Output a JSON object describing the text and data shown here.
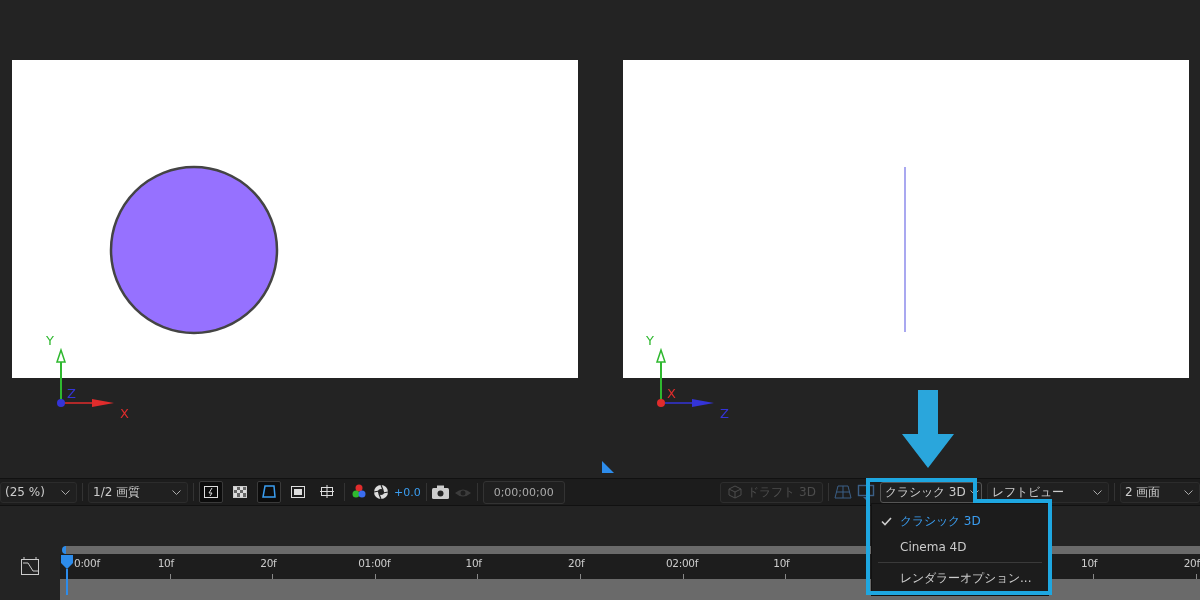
{
  "viewers": [
    {
      "kind": "front",
      "axes": [
        {
          "kind": "up",
          "label": "Y",
          "color": "#2fb82f"
        },
        {
          "kind": "depth",
          "label": "Z",
          "color": "#3434d8"
        },
        {
          "kind": "right",
          "label": "X",
          "color": "#e02c2c"
        }
      ]
    },
    {
      "kind": "side",
      "axes": [
        {
          "kind": "up",
          "label": "Y",
          "color": "#2fb82f"
        },
        {
          "kind": "depth",
          "label": "X",
          "color": "#e02c2c"
        },
        {
          "kind": "right",
          "label": "Z",
          "color": "#3434d8"
        }
      ]
    }
  ],
  "toolbar": {
    "zoom": {
      "value": "(25 %)"
    },
    "resolution": {
      "value": "1/2 画質"
    },
    "view_toggles": [
      {
        "selected": true
      },
      {
        "selected": false
      },
      {
        "selected": true
      },
      {
        "selected": false
      },
      {
        "selected": false
      }
    ],
    "exposure": "+0.0",
    "snapshot_show": {
      "disabled": true
    },
    "timecode": "0;00;00;00",
    "draft_3d": {
      "label": "ドラフト 3D",
      "disabled": true
    },
    "renderer": {
      "value": "クラシック 3D",
      "expanded": true
    },
    "view": {
      "value": "レフトビュー"
    },
    "layout": {
      "value": "2 画面"
    }
  },
  "renderer_menu": [
    {
      "kind": "item",
      "label": "クラシック 3D",
      "checked": true
    },
    {
      "kind": "item",
      "label": "Cinema 4D",
      "checked": false
    },
    {
      "kind": "separator"
    },
    {
      "kind": "item",
      "label": "レンダラーオプション...",
      "checked": false
    }
  ],
  "timeline": {
    "ticks": [
      {
        "label": "0:00f"
      },
      {
        "label": "10f"
      },
      {
        "label": "20f"
      },
      {
        "label": "01:00f"
      },
      {
        "label": "10f"
      },
      {
        "label": "20f"
      },
      {
        "label": "02:00f"
      },
      {
        "label": "10f"
      },
      {
        "label": "10f",
        "after_gap": true
      },
      {
        "label": "20f"
      }
    ]
  }
}
